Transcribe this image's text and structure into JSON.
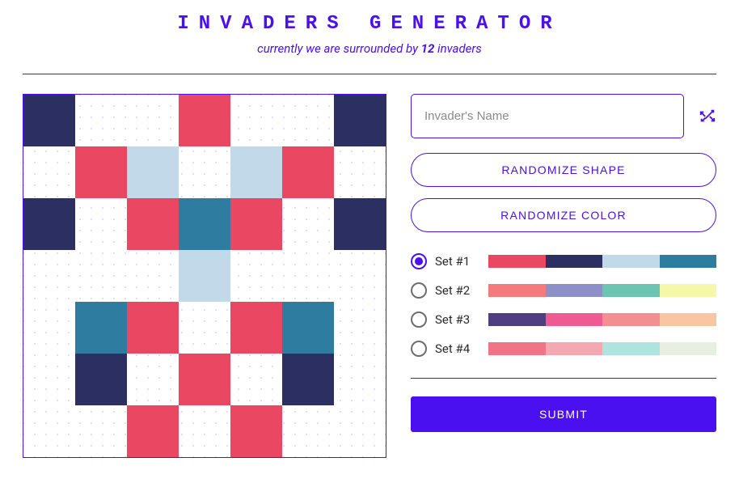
{
  "title": "INVADERS GENERATOR",
  "subtitle_prefix": "currently we are surrounded by ",
  "invader_count": "12",
  "subtitle_suffix": " invaders",
  "name_placeholder": "Invader's Name",
  "btn_shape": "RANDOMIZE SHAPE",
  "btn_color": "RANDOMIZE COLOR",
  "btn_submit": "SUBMIT",
  "palette": {
    "a": "#ea4763",
    "b": "#2b2f62",
    "c": "#c2d9ea",
    "d": "#2f7ca1"
  },
  "grid_rows": [
    [
      "b",
      "",
      "",
      "a",
      "",
      "",
      "b"
    ],
    [
      "",
      "a",
      "c",
      "",
      "c",
      "a",
      ""
    ],
    [
      "b",
      "",
      "a",
      "d",
      "a",
      "",
      "b"
    ],
    [
      "",
      "",
      "",
      "c",
      "",
      "",
      ""
    ],
    [
      "",
      "d",
      "a",
      "",
      "a",
      "d",
      ""
    ],
    [
      "",
      "b",
      "",
      "a",
      "",
      "b",
      ""
    ],
    [
      "",
      "",
      "a",
      "",
      "a",
      "",
      ""
    ]
  ],
  "sets": [
    {
      "label": "Set #1",
      "selected": true,
      "colors": [
        "#ea4763",
        "#2b2f62",
        "#c2d9ea",
        "#2f7ca1"
      ]
    },
    {
      "label": "Set #2",
      "selected": false,
      "colors": [
        "#f57a7d",
        "#8c8fc8",
        "#6cc5b1",
        "#f5f8a9"
      ]
    },
    {
      "label": "Set #3",
      "selected": false,
      "colors": [
        "#4f3f80",
        "#ef5a92",
        "#f38f90",
        "#f8c6a1"
      ]
    },
    {
      "label": "Set #4",
      "selected": false,
      "colors": [
        "#f07487",
        "#f4a8b1",
        "#afe3dd",
        "#e7efe2"
      ]
    }
  ]
}
